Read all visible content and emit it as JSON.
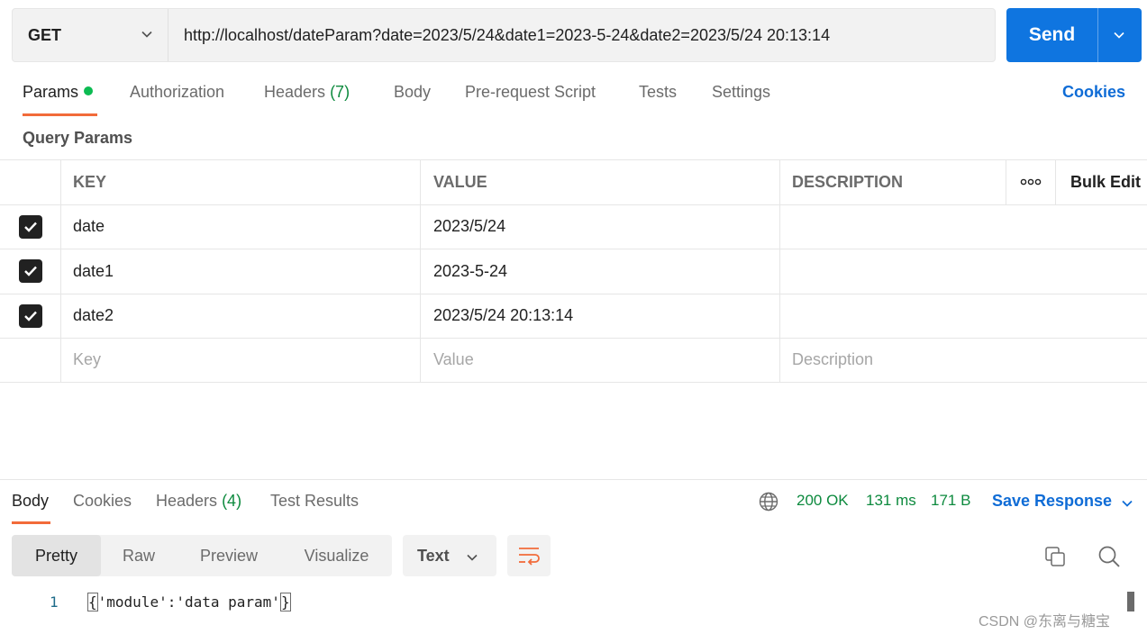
{
  "request": {
    "method": "GET",
    "url": "http://localhost/dateParam?date=2023/5/24&date1=2023-5-24&date2=2023/5/24 20:13:14",
    "send_label": "Send"
  },
  "tabs": {
    "params": "Params",
    "authorization": "Authorization",
    "headers": "Headers",
    "headers_count": "(7)",
    "body": "Body",
    "prerequest": "Pre-request Script",
    "tests": "Tests",
    "settings": "Settings",
    "cookies": "Cookies"
  },
  "query_params": {
    "label": "Query Params",
    "headers": {
      "key": "KEY",
      "value": "VALUE",
      "description": "DESCRIPTION",
      "bulk_edit": "Bulk Edit"
    },
    "rows": [
      {
        "key": "date",
        "value": "2023/5/24",
        "description": "",
        "checked": true
      },
      {
        "key": "date1",
        "value": "2023-5-24",
        "description": "",
        "checked": true
      },
      {
        "key": "date2",
        "value": "2023/5/24 20:13:14",
        "description": "",
        "checked": true
      }
    ],
    "placeholders": {
      "key": "Key",
      "value": "Value",
      "description": "Description"
    }
  },
  "response": {
    "tabs": {
      "body": "Body",
      "cookies": "Cookies",
      "headers": "Headers",
      "headers_count": "(4)",
      "test_results": "Test Results"
    },
    "status": "200 OK",
    "time": "131 ms",
    "size": "171 B",
    "save_label": "Save Response",
    "views": [
      "Pretty",
      "Raw",
      "Preview",
      "Visualize"
    ],
    "format": "Text",
    "lines": [
      {
        "num": "1",
        "open": "{",
        "text": "'module':'data param'",
        "close": "}"
      }
    ]
  },
  "watermark": "CSDN @东离与糖宝",
  "colors": {
    "accent": "#f26b3a",
    "send": "#0f75e0",
    "link": "#0f6cd6",
    "success": "#0d8a3e"
  }
}
